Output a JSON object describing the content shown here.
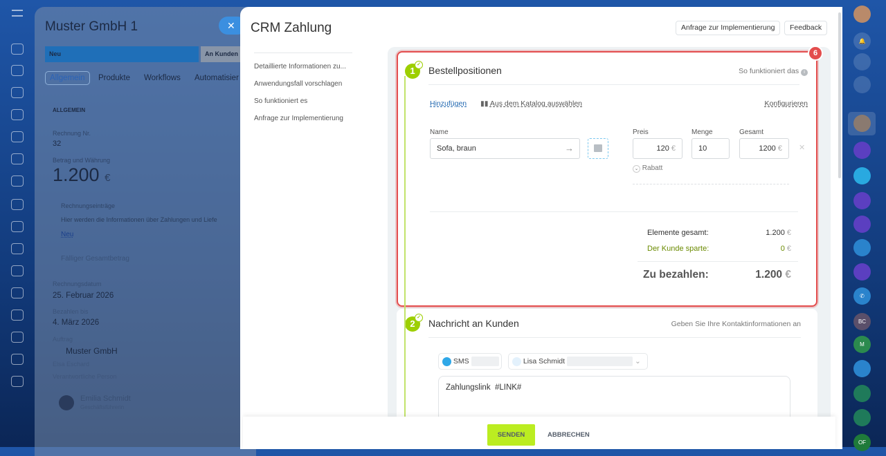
{
  "background_card": {
    "title": "Muster GmbH 1",
    "stage_current": "Neu",
    "stage_next": "An Kunden",
    "tabs": [
      "Allgemein",
      "Produkte",
      "Workflows",
      "Automatisier"
    ],
    "section": "ALLGEMEIN",
    "invoice_no_label": "Rechnung Nr.",
    "invoice_no": "32",
    "amount_label": "Betrag und Währung",
    "amount": "1.200",
    "currency": "€",
    "entries_label": "Rechnungseinträge",
    "entries_text": "Hier werden die Informationen über Zahlungen und Liefe",
    "entries_new": "Neu",
    "due_total_label": "Fälliger Gesamtbetrag",
    "invoice_date_label": "Rechnungsdatum",
    "invoice_date": "25. Februar 2026",
    "pay_until_label": "Bezahlen bis",
    "pay_until": "4. März 2026",
    "order_label": "Auftrag",
    "order": "Muster GmbH",
    "contact": "Elsa Eschard",
    "responsible_label": "Verantwortliche Person",
    "responsible_name": "Emilia Schmidt",
    "responsible_role": "Geschäftsführerin"
  },
  "panel": {
    "title": "CRM Zahlung",
    "header_buttons": [
      "Anfrage zur Implementierung",
      "Feedback"
    ],
    "left_menu": [
      "Detaillierte Informationen zu...",
      "Anwendungsfall vorschlagen",
      "So funktioniert es",
      "Anfrage zur Implementierung"
    ],
    "highlight_badge": "6",
    "step1": {
      "number": "1",
      "title": "Bestellpositionen",
      "help": "So funktioniert das",
      "add": "Hinzufügen",
      "catalog": "Aus dem Katalog auswählen",
      "configure": "Konfigurieren",
      "name_label": "Name",
      "name_value": "Sofa, braun",
      "price_label": "Preis",
      "price": "120",
      "qty_label": "Menge",
      "qty": "10",
      "total_label": "Gesamt",
      "total": "1200",
      "currency": "€",
      "discount": "Rabatt",
      "summary": {
        "items_total_label": "Elemente gesamt:",
        "items_total": "1.200",
        "saved_label": "Der Kunde sparte:",
        "saved": "0",
        "to_pay_label": "Zu bezahlen:",
        "to_pay": "1.200"
      }
    },
    "step2": {
      "number": "2",
      "title": "Nachricht an Kunden",
      "contact_link": "Geben Sie Ihre Kontaktinformationen an",
      "channel": "SMS",
      "recipient": "Lisa Schmidt",
      "message": "Zahlungslink  #LINK#"
    },
    "footer": {
      "send": "SENDEN",
      "cancel": "ABBRECHEN"
    }
  },
  "right_rail": {
    "badges": [
      "BC",
      "M",
      "OF"
    ]
  },
  "colors": {
    "accent_green": "#bbed21",
    "step_green": "#9dcf00",
    "highlight_red": "#e34d4d",
    "link_blue": "#2067b0"
  }
}
